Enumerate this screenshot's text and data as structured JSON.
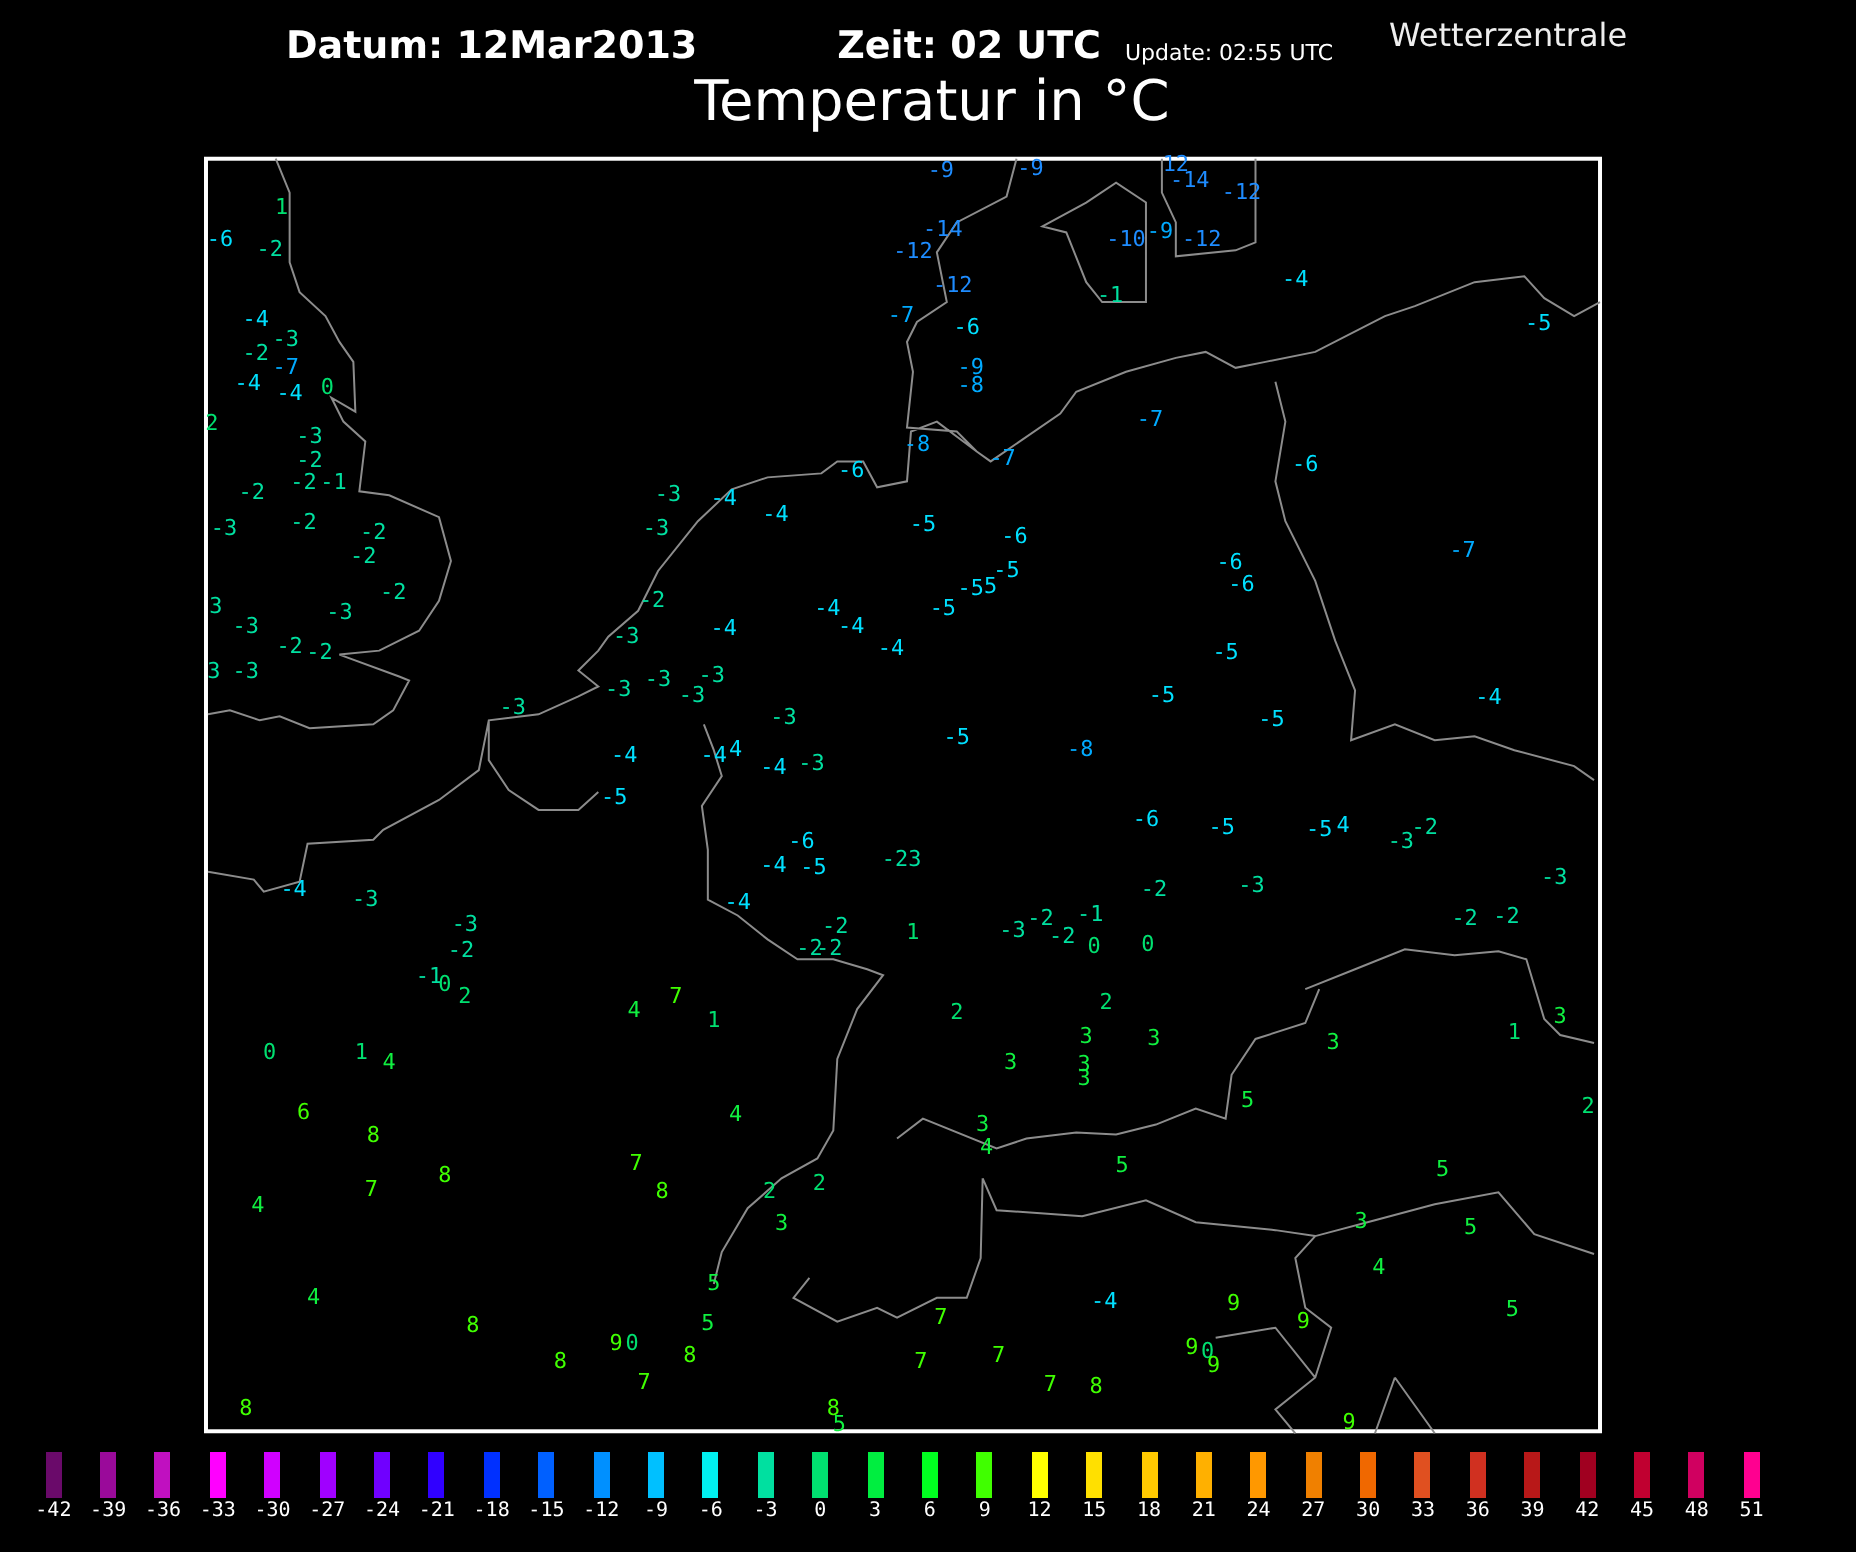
{
  "header": {
    "date": "Datum: 12Mar2013",
    "time": "Zeit: 02 UTC",
    "update": "Update: 02:55 UTC",
    "brand": "Wetterzentrale",
    "title": "Temperatur in °C"
  },
  "stations": [
    {
      "reading": "1",
      "color": "#00e070"
    },
    {
      "reading": "-6",
      "color": "#00e0ff"
    },
    {
      "reading": "-2",
      "color": "#00e0a0"
    },
    {
      "reading": "-4",
      "color": "#00e0ff"
    },
    {
      "reading": "-3",
      "color": "#00e0a0"
    },
    {
      "reading": "-2",
      "color": "#00e0a0"
    },
    {
      "reading": "-7",
      "color": "#00aaff"
    },
    {
      "reading": "-4",
      "color": "#00e0ff"
    },
    {
      "reading": "-4",
      "color": "#00e0ff"
    },
    {
      "reading": "0",
      "color": "#00e070"
    },
    {
      "reading": "2",
      "color": "#00e070"
    },
    {
      "reading": "-3",
      "color": "#00e0a0"
    },
    {
      "reading": "-2",
      "color": "#00e0a0"
    },
    {
      "reading": "-2",
      "color": "#00e0a0"
    },
    {
      "reading": "-1",
      "color": "#00e0a0"
    },
    {
      "reading": "-2",
      "color": "#00e0a0"
    },
    {
      "reading": "-3",
      "color": "#00e0a0"
    },
    {
      "reading": "-2",
      "color": "#00e0a0"
    },
    {
      "reading": "-2",
      "color": "#00e0a0"
    },
    {
      "reading": "-2",
      "color": "#00e0a0"
    },
    {
      "reading": "-2",
      "color": "#00e0a0"
    },
    {
      "reading": "3",
      "color": "#00e0a0"
    },
    {
      "reading": "-3",
      "color": "#00e0a0"
    },
    {
      "reading": "-3",
      "color": "#00e0a0"
    },
    {
      "reading": "-2",
      "color": "#00e0a0"
    },
    {
      "reading": "-2",
      "color": "#00e0a0"
    },
    {
      "reading": "3",
      "color": "#00e0a0"
    },
    {
      "reading": "-3",
      "color": "#00e0a0"
    },
    {
      "reading": "-3",
      "color": "#00e0a0"
    },
    {
      "reading": "-4",
      "color": "#00e0ff"
    },
    {
      "reading": "-4",
      "color": "#00e0ff"
    },
    {
      "reading": "-6",
      "color": "#00e0ff"
    },
    {
      "reading": "-3",
      "color": "#00e0a0"
    },
    {
      "reading": "-2",
      "color": "#00e0a0"
    },
    {
      "reading": "-4",
      "color": "#00e0ff"
    },
    {
      "reading": "-4",
      "color": "#00e0ff"
    },
    {
      "reading": "-4",
      "color": "#00e0ff"
    },
    {
      "reading": "-4",
      "color": "#00e0ff"
    },
    {
      "reading": "-3",
      "color": "#00e0a0"
    },
    {
      "reading": "-3",
      "color": "#00e0a0"
    },
    {
      "reading": "-3",
      "color": "#00e0a0"
    },
    {
      "reading": "-3",
      "color": "#00e0a0"
    },
    {
      "reading": "-3",
      "color": "#00e0a0"
    },
    {
      "reading": "-3",
      "color": "#00e0a0"
    },
    {
      "reading": "-3",
      "color": "#00e0a0"
    },
    {
      "reading": "-4",
      "color": "#00e0ff"
    },
    {
      "reading": "-4",
      "color": "#00e0ff"
    },
    {
      "reading": "4",
      "color": "#00e0ff"
    },
    {
      "reading": "-4",
      "color": "#00e0ff"
    },
    {
      "reading": "-3",
      "color": "#00e0a0"
    },
    {
      "reading": "-5",
      "color": "#00e0ff"
    },
    {
      "reading": "-9",
      "color": "#1e8cff"
    },
    {
      "reading": "-9",
      "color": "#1e8cff"
    },
    {
      "reading": "12",
      "color": "#1e8cff"
    },
    {
      "reading": "-14",
      "color": "#1e8cff"
    },
    {
      "reading": "-12",
      "color": "#1e8cff"
    },
    {
      "reading": "-14",
      "color": "#1e8cff"
    },
    {
      "reading": "-12",
      "color": "#1e8cff"
    },
    {
      "reading": "-10",
      "color": "#1e8cff"
    },
    {
      "reading": "-9",
      "color": "#00aaff"
    },
    {
      "reading": "-12",
      "color": "#1e8cff"
    },
    {
      "reading": "-12",
      "color": "#1e8cff"
    },
    {
      "reading": "-1",
      "color": "#00e0a0"
    },
    {
      "reading": "-4",
      "color": "#00e0ff"
    },
    {
      "reading": "-7",
      "color": "#00aaff"
    },
    {
      "reading": "-6",
      "color": "#00e0ff"
    },
    {
      "reading": "-9",
      "color": "#00aaff"
    },
    {
      "reading": "-8",
      "color": "#00aaff"
    },
    {
      "reading": "-5",
      "color": "#00e0ff"
    },
    {
      "reading": "-7",
      "color": "#00aaff"
    },
    {
      "reading": "-8",
      "color": "#00aaff"
    },
    {
      "reading": "-7",
      "color": "#00aaff"
    },
    {
      "reading": "-6",
      "color": "#00e0ff"
    },
    {
      "reading": "-5",
      "color": "#00e0ff"
    },
    {
      "reading": "-6",
      "color": "#00e0ff"
    },
    {
      "reading": "-5",
      "color": "#00e0ff"
    },
    {
      "reading": "-5",
      "color": "#00e0ff"
    },
    {
      "reading": "5",
      "color": "#00e0ff"
    },
    {
      "reading": "-5",
      "color": "#00e0ff"
    },
    {
      "reading": "-6",
      "color": "#00e0ff"
    },
    {
      "reading": "-6",
      "color": "#00e0ff"
    },
    {
      "reading": "-7",
      "color": "#00aaff"
    },
    {
      "reading": "-5",
      "color": "#00e0ff"
    },
    {
      "reading": "-5",
      "color": "#00e0ff"
    },
    {
      "reading": "-4",
      "color": "#00e0ff"
    },
    {
      "reading": "-5",
      "color": "#00e0ff"
    },
    {
      "reading": "-5",
      "color": "#00e0ff"
    },
    {
      "reading": "-8",
      "color": "#00aaff"
    },
    {
      "reading": "-4",
      "color": "#00e0ff"
    },
    {
      "reading": "-3",
      "color": "#00e0a0"
    },
    {
      "reading": "-3",
      "color": "#00e0a0"
    },
    {
      "reading": "-2",
      "color": "#00e0a0"
    },
    {
      "reading": "-1",
      "color": "#00e0a0"
    },
    {
      "reading": "0",
      "color": "#00e070"
    },
    {
      "reading": "2",
      "color": "#00e070"
    },
    {
      "reading": "-6",
      "color": "#00e0ff"
    },
    {
      "reading": "-4",
      "color": "#00e0ff"
    },
    {
      "reading": "-5",
      "color": "#00e0ff"
    },
    {
      "reading": "-2",
      "color": "#00e0a0"
    },
    {
      "reading": "3",
      "color": "#00e0a0"
    },
    {
      "reading": "-4",
      "color": "#00e0ff"
    },
    {
      "reading": "-2",
      "color": "#00e0a0"
    },
    {
      "reading": "-2",
      "color": "#00e0a0"
    },
    {
      "reading": "-2",
      "color": "#00e0a0"
    },
    {
      "reading": "0",
      "color": "#00e070"
    },
    {
      "reading": "1",
      "color": "#00e070"
    },
    {
      "reading": "4",
      "color": "#10f040"
    },
    {
      "reading": "4",
      "color": "#10f040"
    },
    {
      "reading": "7",
      "color": "#40ff00"
    },
    {
      "reading": "1",
      "color": "#00e070"
    },
    {
      "reading": "6",
      "color": "#40ff00"
    },
    {
      "reading": "8",
      "color": "#40ff00"
    },
    {
      "reading": "8",
      "color": "#40ff00"
    },
    {
      "reading": "7",
      "color": "#40ff00"
    },
    {
      "reading": "4",
      "color": "#10f040"
    },
    {
      "reading": "4",
      "color": "#10f040"
    },
    {
      "reading": "7",
      "color": "#40ff00"
    },
    {
      "reading": "8",
      "color": "#40ff00"
    },
    {
      "reading": "2",
      "color": "#00e070"
    },
    {
      "reading": "2",
      "color": "#00e070"
    },
    {
      "reading": "3",
      "color": "#10f040"
    },
    {
      "reading": "5",
      "color": "#10f040"
    },
    {
      "reading": "5",
      "color": "#10f040"
    },
    {
      "reading": "4",
      "color": "#10f040"
    },
    {
      "reading": "8",
      "color": "#40ff00"
    },
    {
      "reading": "9",
      "color": "#40ff00"
    },
    {
      "reading": "0",
      "color": "#00e070"
    },
    {
      "reading": "8",
      "color": "#40ff00"
    },
    {
      "reading": "8",
      "color": "#40ff00"
    },
    {
      "reading": "7",
      "color": "#40ff00"
    },
    {
      "reading": "8",
      "color": "#40ff00"
    },
    {
      "reading": "8",
      "color": "#40ff00"
    },
    {
      "reading": "5",
      "color": "#10f040"
    },
    {
      "reading": "-6",
      "color": "#00e0ff"
    },
    {
      "reading": "-5",
      "color": "#00e0ff"
    },
    {
      "reading": "-5",
      "color": "#00e0ff"
    },
    {
      "reading": "4",
      "color": "#00e0ff"
    },
    {
      "reading": "-3",
      "color": "#00e0a0"
    },
    {
      "reading": "-2",
      "color": "#00e0a0"
    },
    {
      "reading": "-3",
      "color": "#00e0a0"
    },
    {
      "reading": "-2",
      "color": "#00e0a0"
    },
    {
      "reading": "-3",
      "color": "#00e0a0"
    },
    {
      "reading": "1",
      "color": "#00e070"
    },
    {
      "reading": "-3",
      "color": "#00e0a0"
    },
    {
      "reading": "-2",
      "color": "#00e0a0"
    },
    {
      "reading": "-2",
      "color": "#00e0a0"
    },
    {
      "reading": "-1",
      "color": "#00e0a0"
    },
    {
      "reading": "0",
      "color": "#00e070"
    },
    {
      "reading": "0",
      "color": "#00e070"
    },
    {
      "reading": "-2",
      "color": "#00e0a0"
    },
    {
      "reading": "-2",
      "color": "#00e0a0"
    },
    {
      "reading": "2",
      "color": "#00e070"
    },
    {
      "reading": "2",
      "color": "#00e070"
    },
    {
      "reading": "3",
      "color": "#10f040"
    },
    {
      "reading": "3",
      "color": "#10f040"
    },
    {
      "reading": "3",
      "color": "#10f040"
    },
    {
      "reading": "3",
      "color": "#10f040"
    },
    {
      "reading": "3",
      "color": "#10f040"
    },
    {
      "reading": "3",
      "color": "#10f040"
    },
    {
      "reading": "1",
      "color": "#00e070"
    },
    {
      "reading": "3",
      "color": "#10f040"
    },
    {
      "reading": "5",
      "color": "#10f040"
    },
    {
      "reading": "2",
      "color": "#00e070"
    },
    {
      "reading": "3",
      "color": "#10f040"
    },
    {
      "reading": "4",
      "color": "#10f040"
    },
    {
      "reading": "5",
      "color": "#10f040"
    },
    {
      "reading": "5",
      "color": "#10f040"
    },
    {
      "reading": "3",
      "color": "#10f040"
    },
    {
      "reading": "5",
      "color": "#10f040"
    },
    {
      "reading": "4",
      "color": "#10f040"
    },
    {
      "reading": "5",
      "color": "#10f040"
    },
    {
      "reading": "-4",
      "color": "#00e0ff"
    },
    {
      "reading": "7",
      "color": "#40ff00"
    },
    {
      "reading": "9",
      "color": "#40ff00"
    },
    {
      "reading": "9",
      "color": "#40ff00"
    },
    {
      "reading": "7",
      "color": "#40ff00"
    },
    {
      "reading": "7",
      "color": "#40ff00"
    },
    {
      "reading": "9",
      "color": "#40ff00"
    },
    {
      "reading": "0",
      "color": "#00e070"
    },
    {
      "reading": "9",
      "color": "#40ff00"
    },
    {
      "reading": "7",
      "color": "#40ff00"
    },
    {
      "reading": "8",
      "color": "#40ff00"
    },
    {
      "reading": "9",
      "color": "#40ff00"
    }
  ],
  "legend": [
    {
      "label": "-42",
      "color": "#6a0a6a"
    },
    {
      "label": "-39",
      "color": "#9a0a9a"
    },
    {
      "label": "-36",
      "color": "#c010c0"
    },
    {
      "label": "-33",
      "color": "#ff00ff"
    },
    {
      "label": "-30",
      "color": "#d000ff"
    },
    {
      "label": "-27",
      "color": "#a000ff"
    },
    {
      "label": "-24",
      "color": "#7000ff"
    },
    {
      "label": "-21",
      "color": "#3000ff"
    },
    {
      "label": "-18",
      "color": "#0030ff"
    },
    {
      "label": "-15",
      "color": "#0060ff"
    },
    {
      "label": "-12",
      "color": "#0090ff"
    },
    {
      "label": "-9",
      "color": "#00c0ff"
    },
    {
      "label": "-6",
      "color": "#00f0f0"
    },
    {
      "label": "-3",
      "color": "#00e0a0"
    },
    {
      "label": "0",
      "color": "#00e070"
    },
    {
      "label": "3",
      "color": "#00ee40"
    },
    {
      "label": "6",
      "color": "#00ff20"
    },
    {
      "label": "9",
      "color": "#40ff00"
    },
    {
      "label": "12",
      "color": "#ffff00"
    },
    {
      "label": "15",
      "color": "#ffe000"
    },
    {
      "label": "18",
      "color": "#ffc800"
    },
    {
      "label": "21",
      "color": "#ffb000"
    },
    {
      "label": "24",
      "color": "#ff9800"
    },
    {
      "label": "27",
      "color": "#f08000"
    },
    {
      "label": "30",
      "color": "#f06800"
    },
    {
      "label": "33",
      "color": "#e05020"
    },
    {
      "label": "36",
      "color": "#d03020"
    },
    {
      "label": "39",
      "color": "#b81818"
    },
    {
      "label": "42",
      "color": "#a00020"
    },
    {
      "label": "45",
      "color": "#c00030"
    },
    {
      "label": "48",
      "color": "#d00060"
    },
    {
      "label": "51",
      "color": "#ff0090"
    }
  ]
}
